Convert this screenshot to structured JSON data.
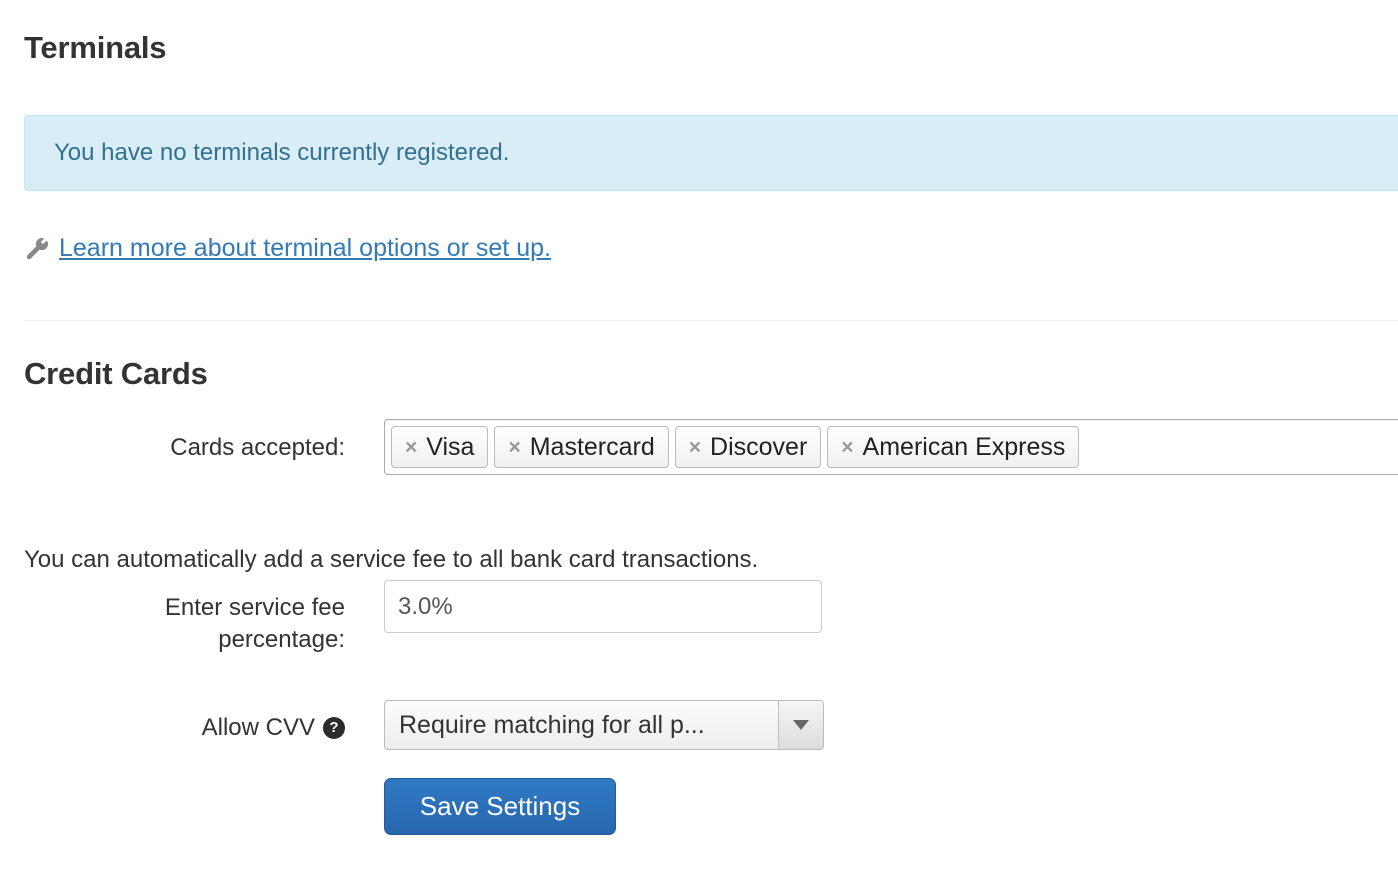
{
  "terminals": {
    "title": "Terminals",
    "alert_text": "You have no terminals currently registered.",
    "link_text": "Learn more about terminal options or set up.",
    "wrench_icon": "wrench-icon"
  },
  "credit_cards": {
    "title": "Credit Cards",
    "cards_accepted_label": "Cards accepted:",
    "cards_accepted": [
      {
        "label": "Visa",
        "remove": "×"
      },
      {
        "label": "Mastercard",
        "remove": "×"
      },
      {
        "label": "Discover",
        "remove": "×"
      },
      {
        "label": "American Express",
        "remove": "×"
      }
    ],
    "service_fee_description": "You can automatically add a service fee to all bank card transactions.",
    "service_fee_label": "Enter service fee percentage:",
    "service_fee_value": "3.0%",
    "allow_cvv_label": "Allow CVV",
    "allow_cvv_help_icon": "?",
    "allow_cvv_value": "Require matching for all p...",
    "save_button": "Save Settings"
  },
  "colors": {
    "link": "#337ab7",
    "alert_bg": "#d9edf7",
    "alert_border": "#bce8f1",
    "alert_text": "#31708f",
    "primary_button": "#2a6ebb",
    "heading": "#333333"
  }
}
